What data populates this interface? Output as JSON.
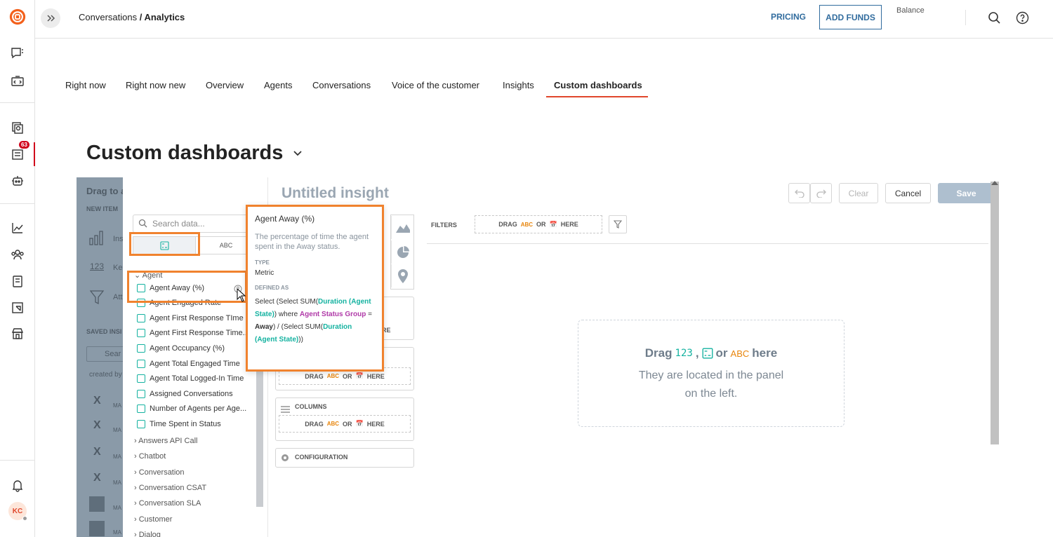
{
  "breadcrumb": {
    "parent": "Conversations",
    "separator": " / ",
    "current": "Analytics"
  },
  "topbar": {
    "pricing": "PRICING",
    "add_funds": "ADD FUNDS",
    "balance": "Balance"
  },
  "rail": {
    "badge": "63",
    "avatar": "KC"
  },
  "tabs": [
    "Right now",
    "Right now new",
    "Overview",
    "Agents",
    "Conversations",
    "Voice of the customer",
    "Insights",
    "Custom dashboards"
  ],
  "page_title": "Custom dashboards",
  "overlay": {
    "drag_to": "Drag to a",
    "new_item": "NEW ITEM",
    "item1": "Ins",
    "item2": "Ke",
    "item3": "Att",
    "saved": "SAVED INSI",
    "search": "Sear",
    "created_by": "created by",
    "ma": "MA"
  },
  "data_panel": {
    "search_placeholder": "Search data...",
    "seg_abc": "ABC",
    "group_agent": "Agent",
    "items": [
      "Agent Away (%)",
      "Agent Engaged Rate",
      "Agent First Response TIme",
      "Agent First Response Time...",
      "Agent Occupancy (%)",
      "Agent Total Engaged Time",
      "Agent Total Logged-In Time",
      "Assigned Conversations",
      "Number of Agents per Age...",
      "Time Spent in Status"
    ],
    "groups": [
      "Answers API Call",
      "Chatbot",
      "Conversation",
      "Conversation CSAT",
      "Conversation SLA",
      "Customer",
      "Dialog"
    ]
  },
  "editor": {
    "title": "Untitled insight",
    "clear": "Clear",
    "cancel": "Cancel",
    "save": "Save",
    "filters": "FILTERS",
    "drag": "DRAG",
    "abc": "ABC",
    "or": "OR",
    "here": "HERE",
    "columns": "COLUMNS",
    "configuration": "CONFIGURATION",
    "partial_here": "RE",
    "empty_drag": "Drag",
    "empty_123": "123",
    "empty_comma": ",",
    "empty_or": "or",
    "empty_abc": "ABC",
    "empty_here": "here",
    "empty_line1": "They are located in the panel",
    "empty_line2": "on the left."
  },
  "tooltip": {
    "title": "Agent Away (%)",
    "description": "The percentage of time the agent spent in the Away status.",
    "type_label": "TYPE",
    "type_value": "Metric",
    "defined_label": "DEFINED AS",
    "def_1": "Select (Select SUM(",
    "def_2": "Duration (Agent State)",
    "def_3": ") where ",
    "def_4": "Agent Status Group",
    "def_5": " = ",
    "def_6": "Away",
    "def_7": ") / (Select SUM(",
    "def_8": "Duration (Agent State)",
    "def_9": "))"
  }
}
